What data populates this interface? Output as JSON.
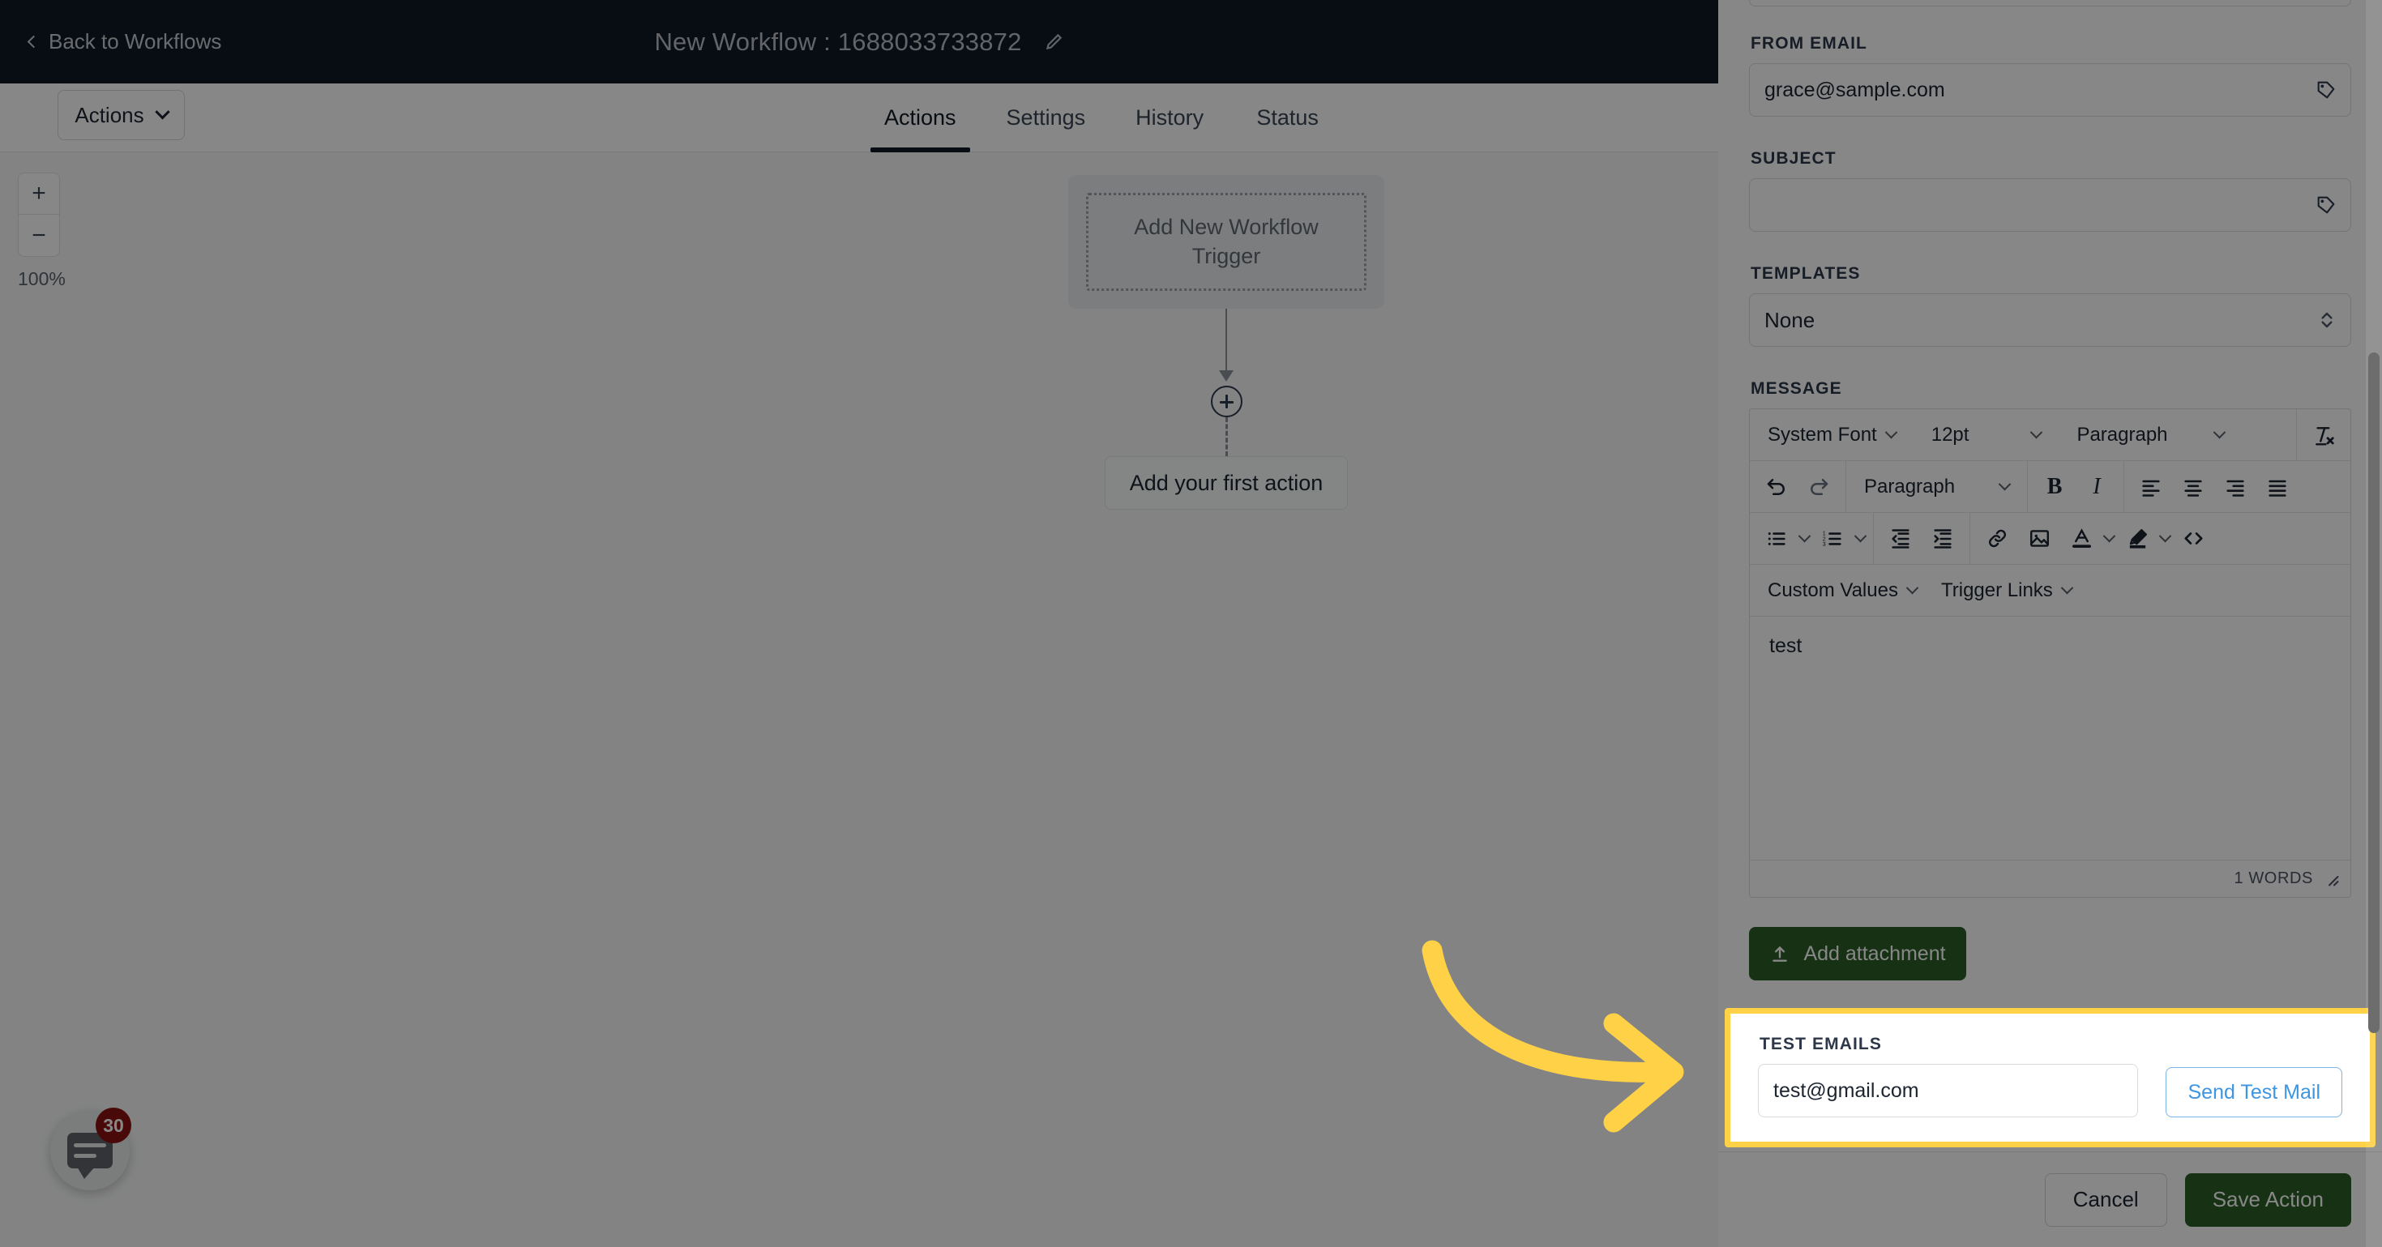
{
  "topbar": {
    "back_label": "Back to Workflows",
    "back_icon": "chevron-left-icon",
    "title": "New Workflow : 1688033733872",
    "edit_icon": "pencil-icon"
  },
  "tabsbar": {
    "actions_button_label": "Actions",
    "tabs": [
      {
        "label": "Actions",
        "active": true
      },
      {
        "label": "Settings",
        "active": false
      },
      {
        "label": "History",
        "active": false
      },
      {
        "label": "Status",
        "active": false
      }
    ]
  },
  "canvas": {
    "zoom": {
      "in_label": "+",
      "out_label": "−",
      "level": "100%"
    },
    "trigger_placeholder": "Add New Workflow Trigger",
    "add_node_icon": "plus-circle-icon",
    "first_action_label": "Add your first action",
    "chat_widget": {
      "icon": "chat-bubble-icon",
      "badge": "30"
    }
  },
  "panel": {
    "from_email": {
      "label": "FROM EMAIL",
      "value": "grace@sample.com",
      "tag_icon": "tag-icon"
    },
    "subject": {
      "label": "SUBJECT",
      "value": "",
      "placeholder": "",
      "tag_icon": "tag-icon"
    },
    "templates": {
      "label": "TEMPLATES",
      "value": "None",
      "chevron_icon": "up-down-chevron-icon"
    },
    "message": {
      "label": "MESSAGE",
      "toolbar_row1": [
        {
          "name": "font-family-select",
          "label": "System Font",
          "chevron": true
        },
        {
          "name": "font-size-select",
          "label": "12pt",
          "chevron": true
        },
        {
          "name": "block-format-select",
          "label": "Paragraph",
          "chevron": true
        },
        {
          "name": "clear-formatting-button",
          "icon": "clear-formatting-icon"
        }
      ],
      "toolbar_row2": [
        {
          "name": "undo-button",
          "icon": "undo-icon"
        },
        {
          "name": "redo-button",
          "icon": "redo-icon"
        },
        {
          "name": "paragraph-style-select",
          "label": "Paragraph",
          "chevron": true
        },
        {
          "name": "bold-button",
          "icon": "bold-icon",
          "label": "B"
        },
        {
          "name": "italic-button",
          "icon": "italic-icon",
          "label": "I"
        },
        {
          "name": "align-left-button",
          "icon": "align-left-icon"
        },
        {
          "name": "align-center-button",
          "icon": "align-center-icon"
        },
        {
          "name": "align-right-button",
          "icon": "align-right-icon"
        },
        {
          "name": "align-justify-button",
          "icon": "align-justify-icon"
        }
      ],
      "toolbar_row3": [
        {
          "name": "bullet-list-button",
          "icon": "bullet-list-icon",
          "chevron": true
        },
        {
          "name": "numbered-list-button",
          "icon": "numbered-list-icon",
          "chevron": true
        },
        {
          "name": "outdent-button",
          "icon": "outdent-icon"
        },
        {
          "name": "indent-button",
          "icon": "indent-icon"
        },
        {
          "name": "insert-link-button",
          "icon": "link-icon"
        },
        {
          "name": "insert-image-button",
          "icon": "image-icon"
        },
        {
          "name": "text-color-button",
          "icon": "text-color-icon",
          "chevron": true
        },
        {
          "name": "highlight-color-button",
          "icon": "highlight-icon",
          "chevron": true
        },
        {
          "name": "source-code-button",
          "icon": "code-icon"
        }
      ],
      "toolbar_row4": [
        {
          "name": "custom-values-menu",
          "label": "Custom Values",
          "chevron": true
        },
        {
          "name": "trigger-links-menu",
          "label": "Trigger Links",
          "chevron": true
        }
      ],
      "body": "test",
      "word_count": "1 WORDS",
      "resize_icon": "resize-grip-icon"
    },
    "add_attachment": {
      "label": "Add attachment",
      "icon": "upload-icon"
    },
    "test_emails": {
      "label": "TEST EMAILS",
      "value": "test@gmail.com",
      "send_button_label": "Send Test Mail"
    },
    "footer": {
      "cancel_label": "Cancel",
      "save_label": "Save Action"
    }
  },
  "annotation": {
    "arrow_icon": "curved-arrow-right-icon",
    "color": "#ffd147"
  },
  "colors": {
    "topbar_bg": "#0f1923",
    "accent_green": "#2a5e24",
    "link_blue": "#3e95e0",
    "highlight_yellow": "#ffd147",
    "badge_red": "#8b1111"
  }
}
